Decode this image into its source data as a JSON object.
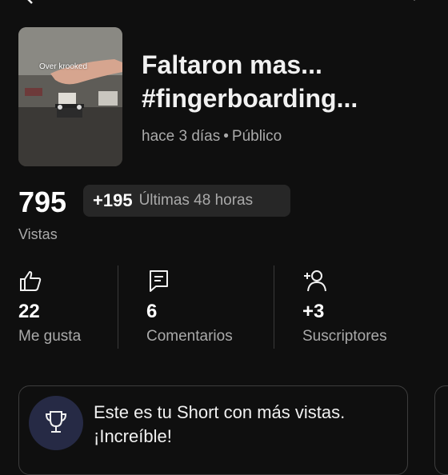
{
  "video": {
    "thumbnail_caption": "Over krooked",
    "title": "Faltaron mas... #fingerboarding...",
    "age": "hace 3 días",
    "separator": "•",
    "visibility": "Público"
  },
  "views": {
    "count": "795",
    "delta": "+195",
    "delta_period": "Últimas 48 horas",
    "label": "Vistas"
  },
  "stats": [
    {
      "icon": "thumbs-up-icon",
      "value": "22",
      "label": "Me gusta"
    },
    {
      "icon": "comment-icon",
      "value": "6",
      "label": "Comentarios"
    },
    {
      "icon": "add-person-icon",
      "value": "+3",
      "label": "Suscriptores"
    }
  ],
  "highlight": {
    "icon": "trophy-icon",
    "line1": "Este es tu Short con más vistas.",
    "line2": "¡Increíble!"
  },
  "colors": {
    "background": "#0f0f0f",
    "secondary_text": "#aaaaaa",
    "pill": "#272727",
    "trophy_circle": "#262a45"
  }
}
